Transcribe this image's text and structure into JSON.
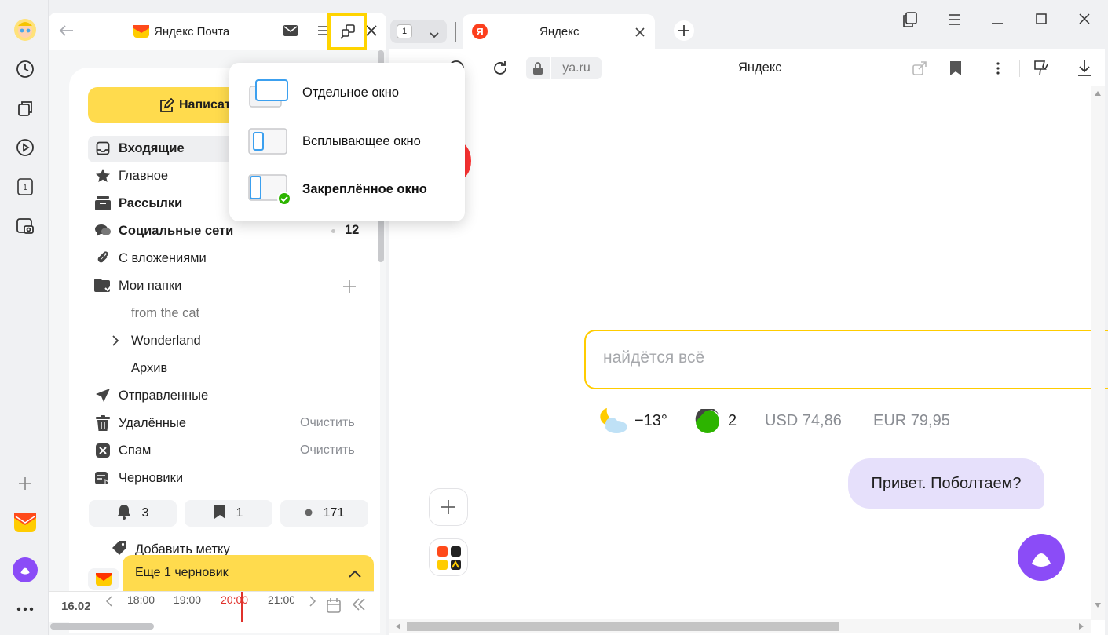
{
  "panel": {
    "title": "Яндекс Почта",
    "compose_label": "Написать",
    "folders": [
      {
        "name": "Входящие",
        "count": ""
      },
      {
        "name": "Главное",
        "count": ""
      },
      {
        "name": "Рассылки",
        "count": ""
      },
      {
        "name": "Социальные сети",
        "count": "12"
      },
      {
        "name": "С вложениями",
        "count": ""
      },
      {
        "name": "Мои папки",
        "count": ""
      },
      {
        "name": "Отправленные",
        "count": ""
      },
      {
        "name": "Удалённые",
        "count": ""
      },
      {
        "name": "Спам",
        "count": ""
      },
      {
        "name": "Черновики",
        "count": ""
      }
    ],
    "subfolders": [
      "from the cat",
      "Wonderland",
      "Архив"
    ],
    "clear_label": "Очистить",
    "pills": {
      "notify": "3",
      "bookmark": "1",
      "dot": "171"
    },
    "add_label": "Добавить метку",
    "draft_banner": "Еще 1 черновик",
    "timeline": {
      "date": "16.02",
      "times": [
        "18:00",
        "19:00",
        "20:00",
        "21:00"
      ]
    }
  },
  "popup": {
    "items": [
      "Отдельное окно",
      "Всплывающее окно",
      "Закреплённое окно"
    ]
  },
  "browser": {
    "tab_count": "1",
    "tab_title": "Яндекс",
    "address": "ya.ru",
    "page_title": "Яндекс",
    "search_placeholder": "найдётся всё",
    "weather": "−13°",
    "traffic": "2",
    "usd": "USD 74,86",
    "eur": "EUR 79,95",
    "alice_bubble": "Привет. Поболтаем?"
  },
  "colors": {
    "accent_yellow": "#ffdb4d",
    "highlight": "#ffd400",
    "alice": "#8b4cf7",
    "bubble": "#e5e0fa"
  }
}
